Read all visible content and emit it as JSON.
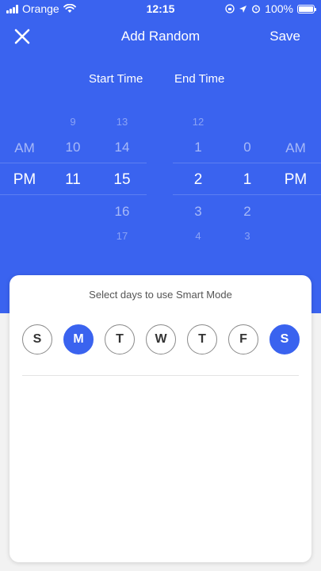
{
  "status_bar": {
    "carrier": "Orange",
    "time": "12:15",
    "battery": "100%"
  },
  "nav": {
    "title": "Add Random",
    "save_label": "Save"
  },
  "times": {
    "start_label": "Start Time",
    "end_label": "End Time"
  },
  "pickers": {
    "start_ampm": {
      "above": "AM",
      "selected": "PM"
    },
    "start_hour": {
      "above2": "9",
      "above1": "10",
      "selected": "11"
    },
    "start_minute": {
      "above2": "13",
      "above1": "14",
      "selected": "15",
      "below1": "16",
      "below2": "17"
    },
    "end_hour": {
      "above2": "12",
      "above1": "1",
      "selected": "2",
      "below1": "3",
      "below2": "4"
    },
    "end_minute": {
      "above1": "0",
      "selected": "1",
      "below1": "2",
      "below2": "3"
    },
    "end_ampm": {
      "above": "AM",
      "selected": "PM"
    }
  },
  "smart_mode": {
    "title": "Select days to use Smart Mode",
    "days": [
      {
        "label": "S",
        "selected": false
      },
      {
        "label": "M",
        "selected": true
      },
      {
        "label": "T",
        "selected": false
      },
      {
        "label": "W",
        "selected": false
      },
      {
        "label": "T",
        "selected": false
      },
      {
        "label": "F",
        "selected": false
      },
      {
        "label": "S",
        "selected": true
      }
    ]
  },
  "colors": {
    "accent": "#3a63ef",
    "background": "#f2f2f2"
  }
}
